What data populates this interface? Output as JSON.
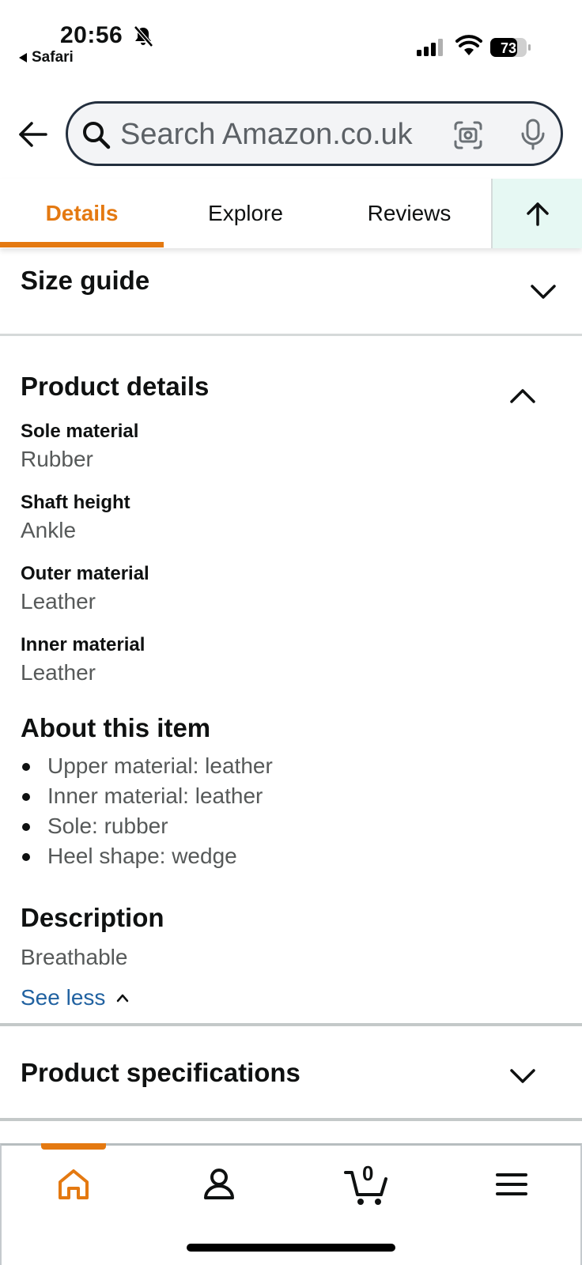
{
  "status_bar": {
    "time": "20:56",
    "back_app": "Safari",
    "battery": "73"
  },
  "search": {
    "placeholder": "Search Amazon.co.uk",
    "icons": [
      "back-arrow-icon",
      "search-icon",
      "camera-lens-icon",
      "microphone-icon"
    ]
  },
  "tabs": {
    "items": [
      {
        "label": "Details",
        "active": true
      },
      {
        "label": "Explore",
        "active": false
      },
      {
        "label": "Reviews",
        "active": false
      }
    ],
    "accent": "#e47911",
    "scroll_top_bg": "#e6f8f3"
  },
  "size_guide": {
    "title": "Size guide",
    "expanded": false
  },
  "product_details": {
    "title": "Product details",
    "expanded": true,
    "attributes": [
      {
        "label": "Sole material",
        "value": "Rubber"
      },
      {
        "label": "Shaft height",
        "value": "Ankle"
      },
      {
        "label": "Outer material",
        "value": "Leather"
      },
      {
        "label": "Inner material",
        "value": "Leather"
      }
    ],
    "about_title": "About this item",
    "about_items": [
      "Upper material: leather",
      "Inner material: leather",
      "Sole: rubber",
      "Heel shape: wedge"
    ],
    "description_title": "Description",
    "description_text": "Breathable",
    "see_less": "See less",
    "link_color": "#2162a1"
  },
  "product_specifications": {
    "title": "Product specifications",
    "expanded": false
  },
  "bottom_nav": {
    "items": [
      {
        "icon": "home-icon",
        "active": true
      },
      {
        "icon": "account-icon",
        "active": false
      },
      {
        "icon": "cart-icon",
        "active": false,
        "count": "0"
      },
      {
        "icon": "menu-icon",
        "active": false
      }
    ]
  }
}
